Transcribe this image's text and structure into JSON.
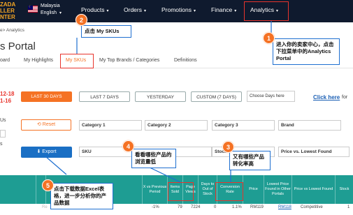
{
  "logo": {
    "line1": "ZADA",
    "line2": "LLER",
    "line3": "NTER"
  },
  "locale": {
    "country": "Malaysia",
    "language": "English"
  },
  "nav": [
    {
      "label": "Products"
    },
    {
      "label": "Orders"
    },
    {
      "label": "Promotions"
    },
    {
      "label": "Finance"
    },
    {
      "label": "Analytics"
    }
  ],
  "breadcrumb": "e> Analytics",
  "page_title": "s Portal",
  "tabs": [
    {
      "label": "oard"
    },
    {
      "label": "My Highlights"
    },
    {
      "label": "My SKUs"
    },
    {
      "label": "My Top Brands / Categories"
    },
    {
      "label": "Definitions"
    }
  ],
  "date_range": {
    "line1": "12-18",
    "line2": "1-16"
  },
  "date_buttons": [
    {
      "label": "LAST 30 DAYS"
    },
    {
      "label": "LAST 7 DAYS"
    },
    {
      "label": "YESTERDAY"
    },
    {
      "label": "CUSTOM (7 DAYS)"
    }
  ],
  "days_input_placeholder": "Choose Days here",
  "click_here": "Click here",
  "click_here_rest": "for",
  "side_labels": {
    "us": "Us",
    "s": "s"
  },
  "reset_label": "Reset",
  "export_label": "Export",
  "filters": {
    "category1": "Category 1",
    "category2": "Category 2",
    "category3": "Category 3",
    "brand": "Brand",
    "sku": "SKU",
    "stock": "Stock",
    "price_vs_lowest": "Price vs. Lowest Found"
  },
  "table": {
    "headers": [
      "X vs Previous Period",
      "Items Sold",
      "Page Views",
      "Days to Out of Stock",
      "Conversion Rate",
      "Price",
      "Lowest Price Found in Other Portals",
      "Price vs Lowest Found",
      "Stock"
    ],
    "row": {
      "prefix": "Re",
      "change": "-1%",
      "items_sold": "79",
      "page_views": "7224",
      "days_oos": "0",
      "conversion": "1.1%",
      "price": "RM119",
      "lowest_price": "RM118",
      "price_vs_lowest": "Competitive",
      "stock": "1"
    }
  },
  "callouts": [
    {
      "num": "1",
      "text": "进入你的卖家中心，点击下拉菜单中的Analytics Portal"
    },
    {
      "num": "2",
      "text": "点击 My SKUs"
    },
    {
      "num": "3",
      "text": "又有哪些产品转化率高"
    },
    {
      "num": "4",
      "text": "看看哪些产品的浏览量低"
    },
    {
      "num": "5",
      "text": "点击下载数据Excel表格，进一步分析你的产品数据"
    }
  ],
  "colors": {
    "nav_bg": "#0f1a2e",
    "accent_orange": "#f57224",
    "table_header": "#1e9d93",
    "highlight_red": "#e8342c",
    "callout_blue": "#1e6fd0",
    "export_blue": "#1a6fc4"
  }
}
